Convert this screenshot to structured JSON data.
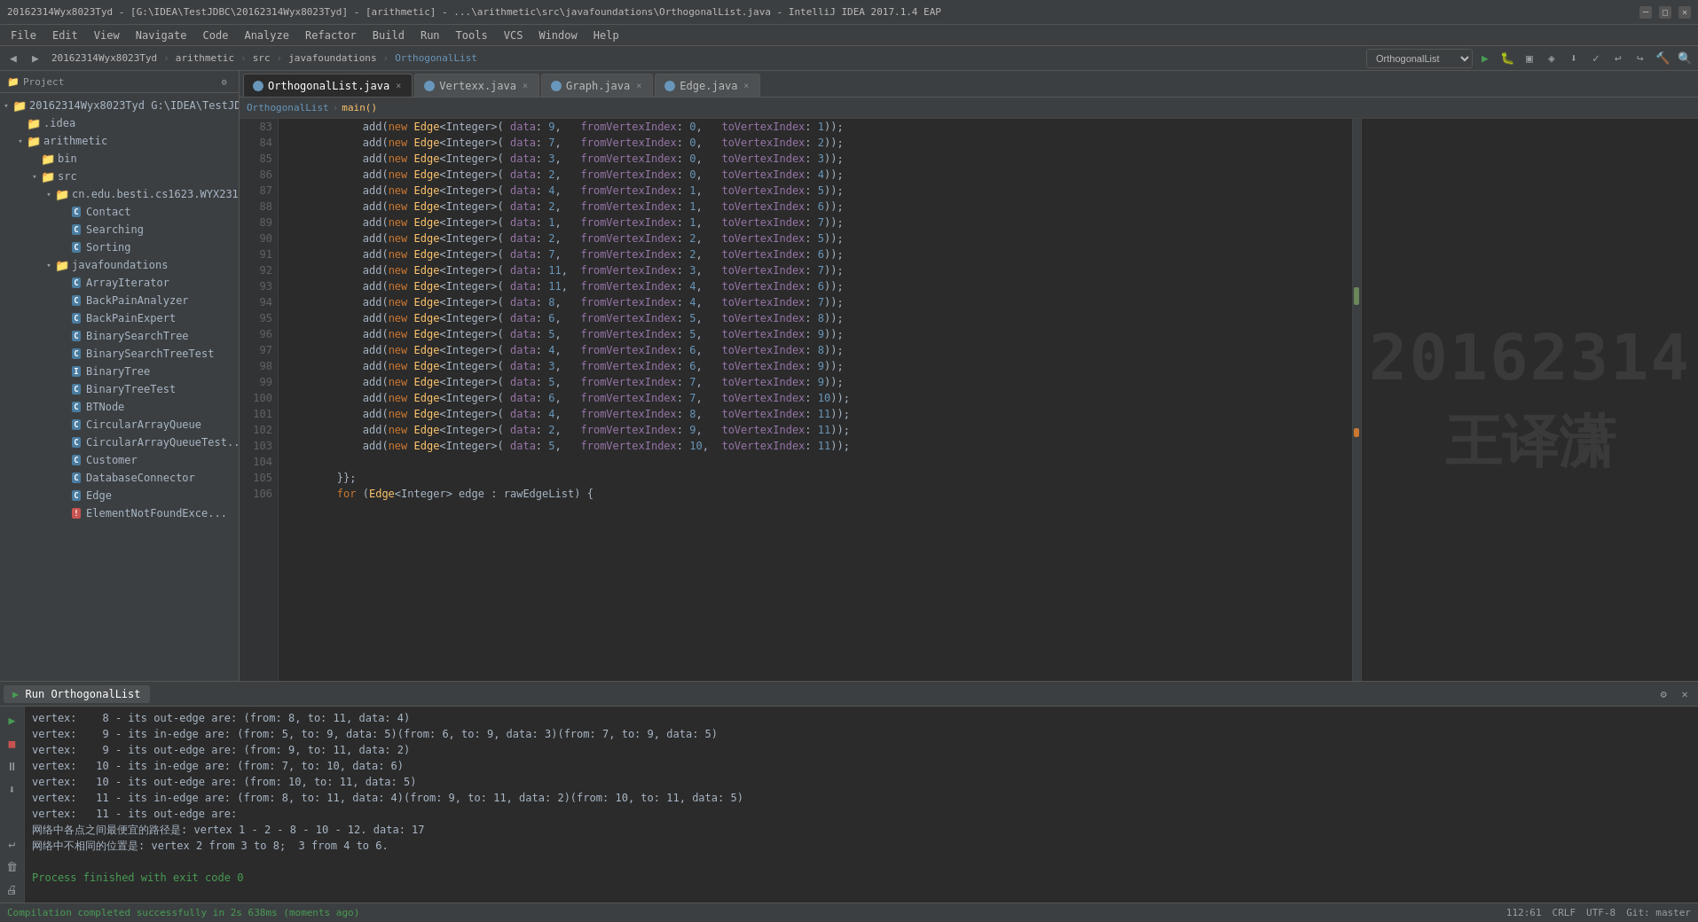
{
  "titleBar": {
    "text": "20162314Wyx8023Tyd - [G:\\IDEA\\TestJDBC\\20162314Wyx8023Tyd] - [arithmetic] - ...\\arithmetic\\src\\javafoundations\\OrthogonalList.java - IntelliJ IDEA 2017.1.4 EAP",
    "minBtn": "─",
    "maxBtn": "□",
    "closeBtn": "✕"
  },
  "menuBar": {
    "items": [
      "File",
      "Edit",
      "View",
      "Navigate",
      "Code",
      "Analyze",
      "Refactor",
      "Build",
      "Run",
      "Tools",
      "VCS",
      "Window",
      "Help"
    ]
  },
  "breadcrumbBar": {
    "items": [
      "20162314Wyx8023Tyd",
      "arithmetic",
      "src",
      "javafoundations",
      "OrthogonalList"
    ]
  },
  "tabs": [
    {
      "name": "OrthogonalList.java",
      "active": true,
      "hasClose": true
    },
    {
      "name": "Vertexx.java",
      "active": false,
      "hasClose": true
    },
    {
      "name": "Graph.java",
      "active": false,
      "hasClose": true
    },
    {
      "name": "Edge.java",
      "active": false,
      "hasClose": true
    }
  ],
  "editorBreadcrumb": {
    "class": "OrthogonalList",
    "method": "main()"
  },
  "sidebar": {
    "header": "Project",
    "tree": [
      {
        "indent": 0,
        "arrow": "▾",
        "icon": "folder",
        "label": "20162314Wyx8023Tyd",
        "sub": "G:\\IDEA\\TestJD..."
      },
      {
        "indent": 1,
        "arrow": "",
        "icon": "folder",
        "label": ".idea"
      },
      {
        "indent": 1,
        "arrow": "▾",
        "icon": "folder-src",
        "label": "arithmetic"
      },
      {
        "indent": 2,
        "arrow": "",
        "icon": "folder",
        "label": "bin"
      },
      {
        "indent": 2,
        "arrow": "▾",
        "icon": "folder",
        "label": "src"
      },
      {
        "indent": 3,
        "arrow": "▾",
        "icon": "folder-pkg",
        "label": "cn.edu.besti.cs1623.WYX2314..."
      },
      {
        "indent": 4,
        "arrow": "",
        "icon": "c",
        "label": "Contact"
      },
      {
        "indent": 4,
        "arrow": "",
        "icon": "c",
        "label": "Searching"
      },
      {
        "indent": 4,
        "arrow": "",
        "icon": "c",
        "label": "Sorting"
      },
      {
        "indent": 3,
        "arrow": "▾",
        "icon": "folder-pkg",
        "label": "javafoundations"
      },
      {
        "indent": 4,
        "arrow": "",
        "icon": "c",
        "label": "ArrayIterator"
      },
      {
        "indent": 4,
        "arrow": "",
        "icon": "c",
        "label": "BackPainAnalyzer"
      },
      {
        "indent": 4,
        "arrow": "",
        "icon": "c",
        "label": "BackPainExpert"
      },
      {
        "indent": 4,
        "arrow": "",
        "icon": "c",
        "label": "BinarySearchTree"
      },
      {
        "indent": 4,
        "arrow": "",
        "icon": "c",
        "label": "BinarySearchTreeTest"
      },
      {
        "indent": 4,
        "arrow": "",
        "icon": "i",
        "label": "BinaryTree"
      },
      {
        "indent": 4,
        "arrow": "",
        "icon": "c",
        "label": "BinaryTreeTest"
      },
      {
        "indent": 4,
        "arrow": "",
        "icon": "c",
        "label": "BTNode"
      },
      {
        "indent": 4,
        "arrow": "",
        "icon": "c",
        "label": "CircularArrayQueue"
      },
      {
        "indent": 4,
        "arrow": "",
        "icon": "c",
        "label": "CircularArrayQueueTest..."
      },
      {
        "indent": 4,
        "arrow": "",
        "icon": "c",
        "label": "Customer"
      },
      {
        "indent": 4,
        "arrow": "",
        "icon": "c",
        "label": "DatabaseConnector"
      },
      {
        "indent": 4,
        "arrow": "",
        "icon": "c",
        "label": "Edge"
      },
      {
        "indent": 4,
        "arrow": "",
        "icon": "err",
        "label": "ElementNotFoundExce..."
      }
    ]
  },
  "codeLines": [
    {
      "num": 83,
      "code": "            add(new Edge<Integer>( data: 9,   fromVertexIndex: 0,   toVertexIndex: 1));"
    },
    {
      "num": 84,
      "code": "            add(new Edge<Integer>( data: 7,   fromVertexIndex: 0,   toVertexIndex: 2));"
    },
    {
      "num": 85,
      "code": "            add(new Edge<Integer>( data: 3,   fromVertexIndex: 0,   toVertexIndex: 3));"
    },
    {
      "num": 86,
      "code": "            add(new Edge<Integer>( data: 2,   fromVertexIndex: 0,   toVertexIndex: 4));"
    },
    {
      "num": 87,
      "code": "            add(new Edge<Integer>( data: 4,   fromVertexIndex: 1,   toVertexIndex: 5));"
    },
    {
      "num": 88,
      "code": "            add(new Edge<Integer>( data: 2,   fromVertexIndex: 1,   toVertexIndex: 6));"
    },
    {
      "num": 89,
      "code": "            add(new Edge<Integer>( data: 1,   fromVertexIndex: 1,   toVertexIndex: 7));"
    },
    {
      "num": 90,
      "code": "            add(new Edge<Integer>( data: 2,   fromVertexIndex: 2,   toVertexIndex: 5));"
    },
    {
      "num": 91,
      "code": "            add(new Edge<Integer>( data: 7,   fromVertexIndex: 2,   toVertexIndex: 6));"
    },
    {
      "num": 92,
      "code": "            add(new Edge<Integer>( data: 11,  fromVertexIndex: 3,   toVertexIndex: 7));"
    },
    {
      "num": 93,
      "code": "            add(new Edge<Integer>( data: 11,  fromVertexIndex: 4,   toVertexIndex: 6));"
    },
    {
      "num": 94,
      "code": "            add(new Edge<Integer>( data: 8,   fromVertexIndex: 4,   toVertexIndex: 7));"
    },
    {
      "num": 95,
      "code": "            add(new Edge<Integer>( data: 6,   fromVertexIndex: 5,   toVertexIndex: 8));"
    },
    {
      "num": 96,
      "code": "            add(new Edge<Integer>( data: 5,   fromVertexIndex: 5,   toVertexIndex: 9));"
    },
    {
      "num": 97,
      "code": "            add(new Edge<Integer>( data: 4,   fromVertexIndex: 6,   toVertexIndex: 8));"
    },
    {
      "num": 98,
      "code": "            add(new Edge<Integer>( data: 3,   fromVertexIndex: 6,   toVertexIndex: 9));"
    },
    {
      "num": 99,
      "code": "            add(new Edge<Integer>( data: 5,   fromVertexIndex: 7,   toVertexIndex: 9));"
    },
    {
      "num": 100,
      "code": "            add(new Edge<Integer>( data: 6,   fromVertexIndex: 7,   toVertexIndex: 10));"
    },
    {
      "num": 101,
      "code": "            add(new Edge<Integer>( data: 4,   fromVertexIndex: 8,   toVertexIndex: 11));"
    },
    {
      "num": 102,
      "code": "            add(new Edge<Integer>( data: 2,   fromVertexIndex: 9,   toVertexIndex: 11));"
    },
    {
      "num": 103,
      "code": "            add(new Edge<Integer>( data: 5,   fromVertexIndex: 10,  toVertexIndex: 11));"
    },
    {
      "num": 104,
      "code": ""
    },
    {
      "num": 105,
      "code": "        }};"
    },
    {
      "num": 106,
      "code": "        for (Edge<Integer> edge : rawEdgeList) {"
    }
  ],
  "watermark": {
    "id": "20162314",
    "name": "王译潇"
  },
  "runTab": {
    "label": "Run",
    "configName": "OrthogonalList"
  },
  "outputLines": [
    "vertex:    8 - its out-edge are: (from: 8, to: 11, data: 4)",
    "vertex:    9 - its in-edge are: (from: 5, to: 9, data: 5)(from: 6, to: 9, data: 3)(from: 7, to: 9, data: 5)",
    "vertex:    9 - its out-edge are: (from: 9, to: 11, data: 2)",
    "vertex:   10 - its in-edge are: (from: 7, to: 10, data: 6)",
    "vertex:   10 - its out-edge are: (from: 10, to: 11, data: 5)",
    "vertex:   11 - its in-edge are: (from: 8, to: 11, data: 4)(from: 9, to: 11, data: 2)(from: 10, to: 11, data: 5)",
    "vertex:   11 - its out-edge are:",
    "网络中各点之间最便宜的路径是: vertex 1 - 2 - 8 - 10 - 12. data: 17",
    "网络中不相同的位置是: vertex 2 from 3 to 8;  3 from 4 to 6.",
    "",
    "Process finished with exit code 0"
  ],
  "statusBar": {
    "compilationStatus": "Compilation completed successfully in 2s 638ms (moments ago)",
    "position": "112:61",
    "crlf": "CRLF",
    "encoding": "UTF-8",
    "indent": "Git: master"
  }
}
